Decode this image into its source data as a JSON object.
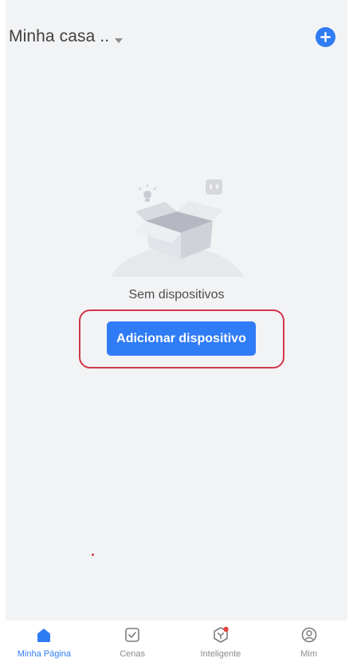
{
  "header": {
    "home_name": "Minha casa ..",
    "add_icon": "plus-circle-icon"
  },
  "empty_state": {
    "message": "Sem dispositivos",
    "button_label": "Adicionar dispositivo",
    "illustration_icon": "empty-box-icon"
  },
  "bottom_nav": {
    "tabs": [
      {
        "label": "Minha Página",
        "icon": "home-icon",
        "active": true
      },
      {
        "label": "Cenas",
        "icon": "checkbox-icon",
        "active": false
      },
      {
        "label": "Inteligente",
        "icon": "smart-icon",
        "active": false
      },
      {
        "label": "Mim",
        "icon": "profile-icon",
        "active": false
      }
    ]
  },
  "colors": {
    "accent": "#2f7cf6",
    "background": "#f2f3f5",
    "highlight_border": "#d2364a",
    "inactive_text": "#8a8a8a"
  }
}
